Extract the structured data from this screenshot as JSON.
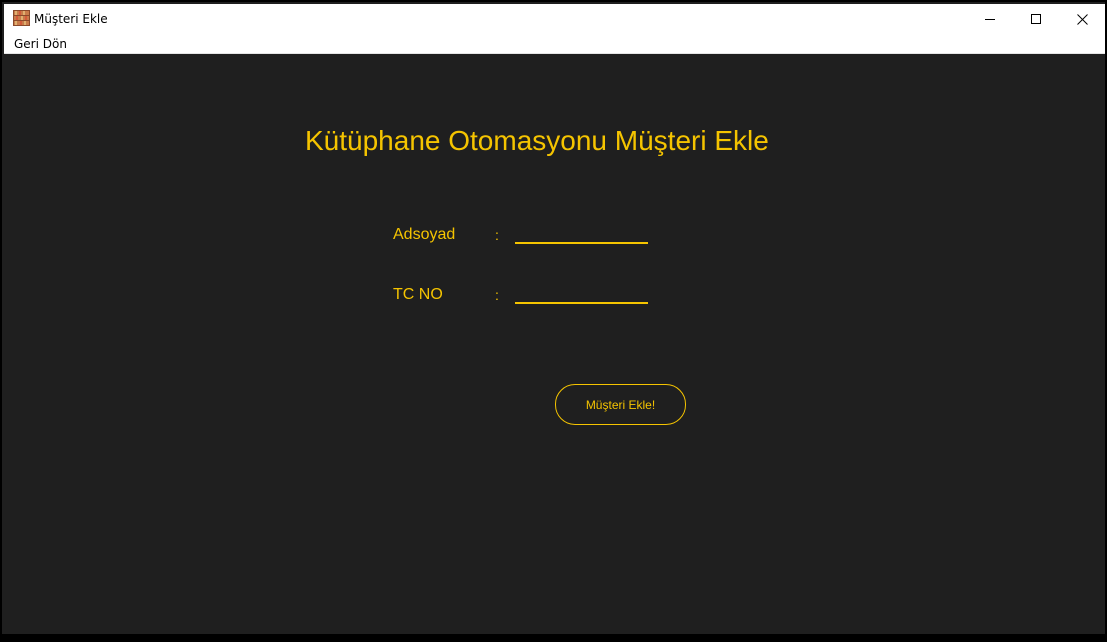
{
  "window": {
    "title": "Müşteri Ekle",
    "app_icon": "bookshelf-icon",
    "controls": [
      "minimize-icon",
      "maximize-icon",
      "close-icon"
    ]
  },
  "menu": {
    "items": [
      {
        "label": "Geri Dön"
      }
    ]
  },
  "form": {
    "heading": "Kütüphane Otomasyonu Müşteri Ekle",
    "fields": [
      {
        "label": "Adsoyad",
        "separator": ":",
        "value": ""
      },
      {
        "label": "TC NO",
        "separator": ":",
        "value": ""
      }
    ],
    "submit_label": "Müşteri Ekle!"
  },
  "colors": {
    "accent": "#f5c400",
    "background": "#1f1f1f",
    "titlebar": "#ffffff"
  }
}
